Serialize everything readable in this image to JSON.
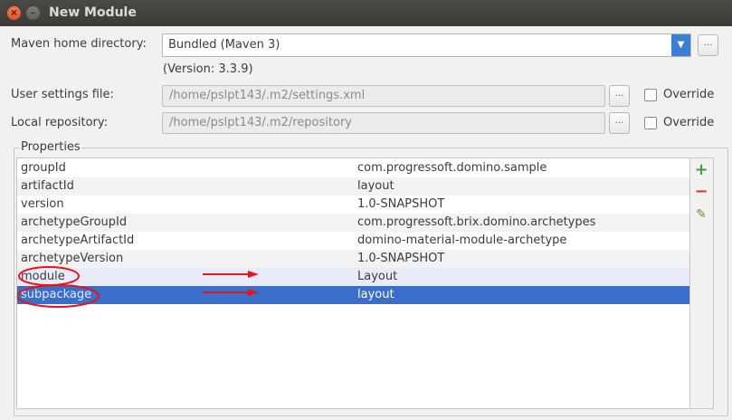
{
  "window": {
    "title": "New Module",
    "close_glyph": "×",
    "minimize_glyph": "–"
  },
  "maven_home": {
    "label": "Maven home directory:",
    "value": "Bundled (Maven 3)",
    "version": "(Version: 3.3.9)",
    "browse_label": "..."
  },
  "user_settings": {
    "label": "User settings file:",
    "value": "/home/pslpt143/.m2/settings.xml",
    "browse_label": "...",
    "override_label": "Override",
    "override_checked": false
  },
  "local_repository": {
    "label": "Local repository:",
    "value": "/home/pslpt143/.m2/repository",
    "browse_label": "...",
    "override_label": "Override",
    "override_checked": false
  },
  "properties": {
    "title": "Properties",
    "rows": [
      {
        "key": "groupId",
        "value": "com.progressoft.domino.sample"
      },
      {
        "key": "artifactId",
        "value": "layout"
      },
      {
        "key": "version",
        "value": "1.0-SNAPSHOT"
      },
      {
        "key": "archetypeGroupId",
        "value": "com.progressoft.brix.domino.archetypes"
      },
      {
        "key": "archetypeArtifactId",
        "value": "domino-material-module-archetype"
      },
      {
        "key": "archetypeVersion",
        "value": "1.0-SNAPSHOT"
      },
      {
        "key": "module",
        "value": "Layout"
      },
      {
        "key": "subpackage",
        "value": "layout"
      }
    ],
    "selected_row": 7,
    "add_glyph": "+",
    "remove_glyph": "−",
    "edit_glyph": "✎"
  },
  "colors": {
    "selection": "#3b6ec8",
    "annotation": "#e8141a",
    "add": "#3aa23a",
    "remove": "#d9372c"
  }
}
